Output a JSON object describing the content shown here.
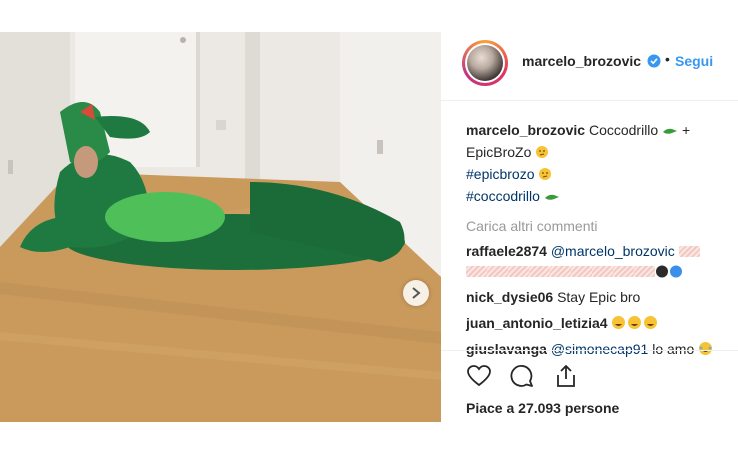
{
  "post": {
    "author": "marcelo_brozovic",
    "follow_label": "Segui",
    "dot": "•",
    "caption_user": "marcelo_brozovic",
    "caption_text": "Coccodrillo",
    "caption_plus": "+",
    "caption_line2": "EpicBroZo",
    "tag1": "#epicbrozo",
    "tag2": "#coccodrillo",
    "load_more": "Carica altri commenti",
    "comments": [
      {
        "user": "raffaele2874",
        "text": "@marcelo_brozovic"
      },
      {
        "user": "nick_dysie06",
        "text": "Stay Epic bro"
      },
      {
        "user": "juan_antonio_letizia4",
        "text": ""
      },
      {
        "user": "giuslavanga",
        "text": "@simonecap91",
        "text2": "lo amo"
      }
    ],
    "likes": "Piace a 27.093 persone"
  },
  "icons": {
    "heart": "heart-icon",
    "comment": "comment-icon",
    "share": "share-icon",
    "verified": "verified-badge-icon",
    "next": "chevron-right-icon"
  },
  "colors": {
    "link": "#3897f0",
    "hashtag": "#003569",
    "muted": "#999999"
  }
}
